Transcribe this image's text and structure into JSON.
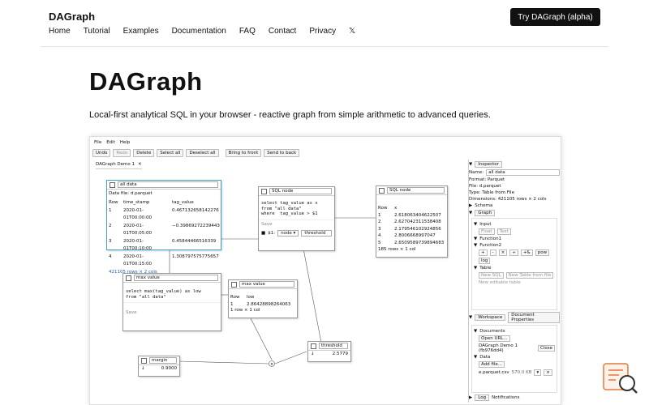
{
  "site": {
    "brand": "DAGraph",
    "nav": [
      "Home",
      "Tutorial",
      "Examples",
      "Documentation",
      "FAQ",
      "Contact",
      "Privacy",
      "𝕏"
    ],
    "cta": "Try DAGraph (alpha)",
    "heading": "DAGraph",
    "tagline": "Local-first analytical SQL in your browser - reactive graph from simple arithmetic to advanced queries."
  },
  "app": {
    "menu": [
      "File",
      "Edit",
      "Help"
    ],
    "toolbar": [
      "Undo",
      "Redo",
      "Delete",
      "Select all",
      "Deselect all",
      "Bring to front",
      "Send to back"
    ],
    "tab": "DAGraph Demo 1",
    "nodes": {
      "all_data": {
        "title": "all data",
        "file_label": "Data file:",
        "file": "d.parquet",
        "cols": [
          "Row",
          "time_stamp",
          "tag_value"
        ],
        "rows": [
          [
            "1",
            "2020-01-01T00:00:00",
            "0.467132658142276"
          ],
          [
            "2",
            "2020-01-01T00:05:00",
            "−0.39869272239443"
          ],
          [
            "3",
            "2020-01-01T00:10:00",
            "0.45844466516339"
          ],
          [
            "4",
            "2020-01-01T00:15:00",
            "1.308797575775657"
          ]
        ],
        "footer": "421105 rows × 2 cols"
      },
      "sql": {
        "title": "SQL node",
        "code": "select tag_value as x\nfrom \"all data\"\nwhere  tag_value > $1",
        "save": "Save",
        "param": "$1:",
        "param_sel": "node ▾",
        "param_val": "threshold"
      },
      "sql2": {
        "title": "SQL node",
        "cols": [
          "Row",
          "x"
        ],
        "rows": [
          [
            "1",
            "2.618063404622507"
          ],
          [
            "2",
            "2.627042311538408"
          ],
          [
            "3",
            "2.179546102924856"
          ],
          [
            "4",
            "2.8006668997047"
          ],
          [
            "5",
            "2.6509589739894683"
          ]
        ],
        "footer": "185 rows × 1 col"
      },
      "maxq": {
        "title": "max value",
        "code": "select max(tag_value) as low\nfrom \"all data\"",
        "save": "Save"
      },
      "maxv": {
        "title": "max value",
        "cols": [
          "Row",
          "low"
        ],
        "rows": [
          [
            "1",
            "2.86428898264063"
          ]
        ],
        "footer": "1 row × 1 col"
      },
      "margin": {
        "title": "margin",
        "value": "0.9000",
        "icon": "↓"
      },
      "threshold": {
        "title": "threshold",
        "value": "2.5779",
        "icon": "↓"
      },
      "op": "×"
    },
    "inspector": {
      "tab": "Inspector",
      "name_label": "Name:",
      "name": "all data",
      "format": "Format:  Parquet",
      "file": "File:  d.parquet",
      "type": "Type:  Table from File",
      "dims": "Dimensions:  421105 rows × 2 cols",
      "schema": "Schema",
      "graph": "Graph",
      "input": "Input",
      "float": "Float",
      "text": "Text",
      "function1": "Function1",
      "function2": "Function2",
      "ops": [
        "+",
        "-",
        "×",
        "÷",
        "+&",
        "pow"
      ],
      "log": "log",
      "table": "Table",
      "new_sql": "New SQL",
      "new_table_file": "New Table from file",
      "new_editable": "New editable table",
      "workspace": "Workspace",
      "doc_props": "Document Properties",
      "documents": "Documents",
      "open_url": "Open URL...",
      "doc_item": "DAGraph Demo 1 (fb976dd4)",
      "close": "Close",
      "data": "Data",
      "add_file": "Add file...",
      "file_row": "e.parquet.csv",
      "file_size": "570.0 KB",
      "log_tab": "Log",
      "notif_tab": "Notifications"
    }
  }
}
